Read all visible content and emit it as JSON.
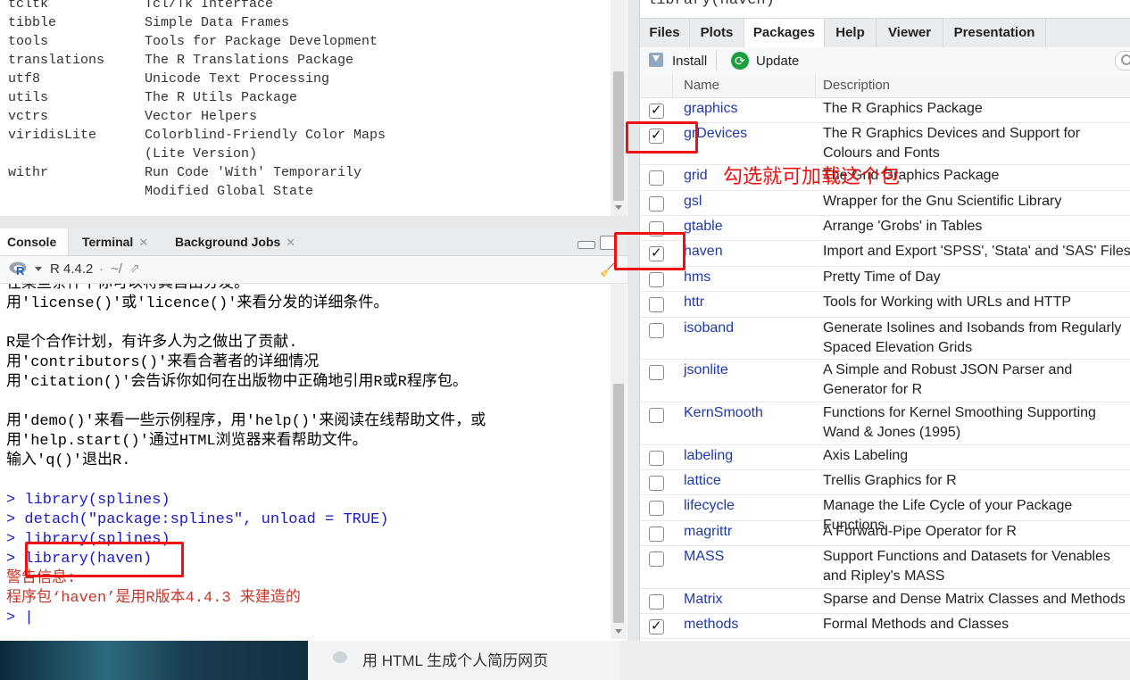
{
  "top_strip": {
    "partial_title": "library(haven)"
  },
  "help_list": [
    {
      "pkg": "tcltk",
      "desc": "Tcl/Tk Interface"
    },
    {
      "pkg": "tibble",
      "desc": "Simple Data Frames"
    },
    {
      "pkg": "tools",
      "desc": "Tools for Package Development"
    },
    {
      "pkg": "translations",
      "desc": "The R Translations Package"
    },
    {
      "pkg": "utf8",
      "desc": "Unicode Text Processing"
    },
    {
      "pkg": "utils",
      "desc": "The R Utils Package"
    },
    {
      "pkg": "vctrs",
      "desc": "Vector Helpers"
    },
    {
      "pkg": "viridisLite",
      "desc": "Colorblind-Friendly Color Maps"
    },
    {
      "pkg": "",
      "desc": "(Lite Version)"
    },
    {
      "pkg": "withr",
      "desc": "Run Code 'With' Temporarily"
    },
    {
      "pkg": "",
      "desc": "Modified Global State"
    }
  ],
  "console": {
    "tabs": [
      {
        "label": "Console",
        "closable": false
      },
      {
        "label": "Terminal",
        "closable": true
      },
      {
        "label": "Background Jobs",
        "closable": true
      }
    ],
    "r_version": "R 4.4.2",
    "path": "~/",
    "lines": [
      {
        "type": "text",
        "text": "在某些条件下你可以将其自由分发。"
      },
      {
        "type": "text",
        "text": "用'license()'或'licence()'来看分发的详细条件。"
      },
      {
        "type": "text",
        "text": ""
      },
      {
        "type": "text",
        "text": "R是个合作计划，有许多人为之做出了贡献."
      },
      {
        "type": "text",
        "text": "用'contributors()'来看合著者的详细情况"
      },
      {
        "type": "text",
        "text": "用'citation()'会告诉你如何在出版物中正确地引用R或R程序包。"
      },
      {
        "type": "text",
        "text": ""
      },
      {
        "type": "text",
        "text": "用'demo()'来看一些示例程序，用'help()'来阅读在线帮助文件，或"
      },
      {
        "type": "text",
        "text": "用'help.start()'通过HTML浏览器来看帮助文件。"
      },
      {
        "type": "text",
        "text": "输入'q()'退出R."
      },
      {
        "type": "text",
        "text": ""
      },
      {
        "type": "cmd",
        "text": "> library(splines)"
      },
      {
        "type": "cmd",
        "text": "> detach(\"package:splines\", unload = TRUE)"
      },
      {
        "type": "cmd",
        "text": "> library(splines)"
      },
      {
        "type": "cmd",
        "text": "> library(haven)"
      },
      {
        "type": "warn",
        "text": "警告信息:"
      },
      {
        "type": "warn",
        "text": "程序包‘haven’是用R版本4.4.3 来建造的"
      },
      {
        "type": "cmd",
        "text": "> |"
      }
    ]
  },
  "right_pane": {
    "tabs": [
      "Files",
      "Plots",
      "Packages",
      "Help",
      "Viewer",
      "Presentation"
    ],
    "active_tab": "Packages",
    "toolbar": {
      "install": "Install",
      "update": "Update"
    },
    "columns": {
      "name": "Name",
      "description": "Description"
    },
    "packages": [
      {
        "name": "graphics",
        "desc": "The R Graphics Package",
        "checked": true
      },
      {
        "name": "grDevices",
        "desc": "The R Graphics Devices and Support for Colours and Fonts",
        "checked": true
      },
      {
        "name": "grid",
        "desc": "The Grid Graphics Package",
        "checked": false
      },
      {
        "name": "gsl",
        "desc": "Wrapper for the Gnu Scientific Library",
        "checked": false
      },
      {
        "name": "gtable",
        "desc": "Arrange 'Grobs' in Tables",
        "checked": false
      },
      {
        "name": "haven",
        "desc": "Import and Export 'SPSS', 'Stata' and 'SAS' Files",
        "checked": true
      },
      {
        "name": "hms",
        "desc": "Pretty Time of Day",
        "checked": false
      },
      {
        "name": "httr",
        "desc": "Tools for Working with URLs and HTTP",
        "checked": false
      },
      {
        "name": "isoband",
        "desc": "Generate Isolines and Isobands from Regularly Spaced Elevation Grids",
        "checked": false
      },
      {
        "name": "jsonlite",
        "desc": "A Simple and Robust JSON Parser and Generator for R",
        "checked": false
      },
      {
        "name": "KernSmooth",
        "desc": "Functions for Kernel Smoothing Supporting Wand & Jones (1995)",
        "checked": false
      },
      {
        "name": "labeling",
        "desc": "Axis Labeling",
        "checked": false
      },
      {
        "name": "lattice",
        "desc": "Trellis Graphics for R",
        "checked": false
      },
      {
        "name": "lifecycle",
        "desc": "Manage the Life Cycle of your Package Functions",
        "checked": false
      },
      {
        "name": "magrittr",
        "desc": "A Forward-Pipe Operator for R",
        "checked": false
      },
      {
        "name": "MASS",
        "desc": "Support Functions and Datasets for Venables and Ripley's MASS",
        "checked": false
      },
      {
        "name": "Matrix",
        "desc": "Sparse and Dense Matrix Classes and Methods",
        "checked": false
      },
      {
        "name": "methods",
        "desc": "Formal Methods and Classes",
        "checked": true
      }
    ]
  },
  "annotation": {
    "text": "勾选就可加载这个包",
    "color": "#ee1111"
  },
  "bottom": {
    "suggestion_text": "用 HTML 生成个人简历网页"
  }
}
